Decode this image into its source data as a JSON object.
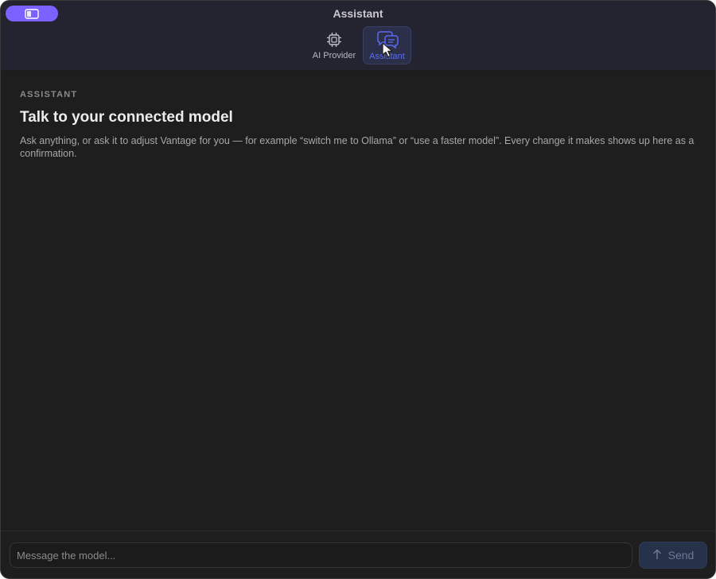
{
  "window": {
    "title": "Assistant"
  },
  "toolbar": {
    "tabs": [
      {
        "label": "AI Provider",
        "icon": "chip-icon",
        "selected": false
      },
      {
        "label": "Assistant",
        "icon": "chat-bubbles-icon",
        "selected": true
      }
    ]
  },
  "main": {
    "section_label": "ASSISTANT",
    "title": "Talk to your connected model",
    "description": "Ask anything, or ask it to adjust Vantage for you — for example “switch me to Ollama” or “use a faster model”. Every change it makes shows up here as a confirmation."
  },
  "composer": {
    "placeholder": "Message the model...",
    "value": "",
    "send_label": "Send"
  },
  "colors": {
    "accent": "#7b61ff",
    "selected_tab_text": "#5b6cf0",
    "background": "#1e1e1e",
    "toolbar_background": "#242431"
  }
}
